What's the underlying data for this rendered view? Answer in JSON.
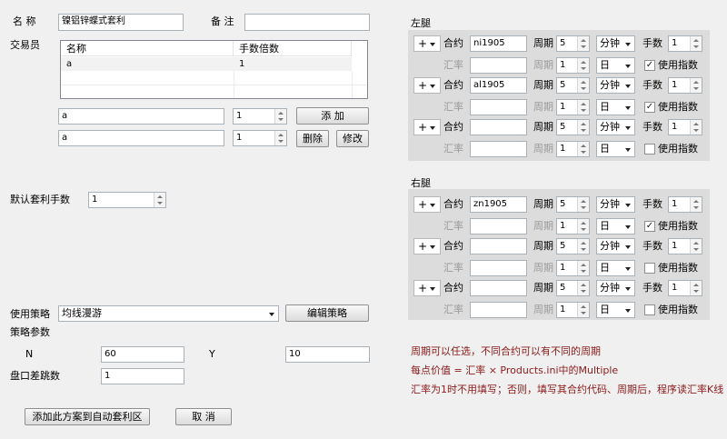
{
  "form": {
    "name_label": "名 称",
    "name_value": "镍铝锌蝶式套利",
    "remark_label": "备 注",
    "remark_value": "",
    "trader_label": "交易员",
    "grid_headers": [
      "名称",
      "手数倍数"
    ],
    "grid_rows": [
      [
        "a",
        "1"
      ]
    ],
    "trader1_name": "a",
    "trader1_qty": "1",
    "add_label": "添  加",
    "trader2_name": "a",
    "trader2_qty": "1",
    "delete_label": "删除",
    "modify_label": "修改",
    "default_qty_label": "默认套利手数",
    "default_qty_value": "1",
    "strategy_label": "使用策略",
    "strategy_value": "均线漫游",
    "edit_strategy_label": "编辑策略",
    "params_label": "策略参数",
    "param_n_label": "N",
    "param_n_value": "60",
    "param_y_label": "Y",
    "param_y_value": "10",
    "slippage_label": "盘口差跳数",
    "slippage_value": "1",
    "add_plan_label": "添加此方案到自动套利区",
    "cancel_label": "取 消"
  },
  "labels": {
    "contract": "合约",
    "period": "周期",
    "lots": "手数",
    "rate": "汇率",
    "use_index": "使用指数"
  },
  "left_leg": {
    "title": "左腿",
    "legs": [
      {
        "sign": "+",
        "contract": "ni1905",
        "period": "5",
        "unit": "分钟",
        "lots": "1",
        "rate": "",
        "rate_period": "1",
        "rate_unit": "日",
        "use_index": true
      },
      {
        "sign": "+",
        "contract": "al1905",
        "period": "5",
        "unit": "分钟",
        "lots": "1",
        "rate": "",
        "rate_period": "1",
        "rate_unit": "日",
        "use_index": true
      },
      {
        "sign": "+",
        "contract": "",
        "period": "5",
        "unit": "分钟",
        "lots": "1",
        "rate": "",
        "rate_period": "1",
        "rate_unit": "日",
        "use_index": false
      }
    ]
  },
  "right_leg": {
    "title": "右腿",
    "legs": [
      {
        "sign": "+",
        "contract": "zn1905",
        "period": "5",
        "unit": "分钟",
        "lots": "1",
        "rate": "",
        "rate_period": "1",
        "rate_unit": "日",
        "use_index": true
      },
      {
        "sign": "+",
        "contract": "",
        "period": "5",
        "unit": "分钟",
        "lots": "1",
        "rate": "",
        "rate_period": "1",
        "rate_unit": "日",
        "use_index": false
      },
      {
        "sign": "+",
        "contract": "",
        "period": "5",
        "unit": "分钟",
        "lots": "1",
        "rate": "",
        "rate_period": "1",
        "rate_unit": "日",
        "use_index": false
      }
    ]
  },
  "notes": [
    "周期可以任选，不同合约可以有不同的周期",
    "每点价值 = 汇率 × Products.ini中的Multiple",
    "汇率为1时不用填写；否则，填写其合约代码、周期后，程序读汇率K线"
  ],
  "colors": {
    "note_text": "#8b1a1a",
    "panel_bg": "#dcdcdc"
  }
}
